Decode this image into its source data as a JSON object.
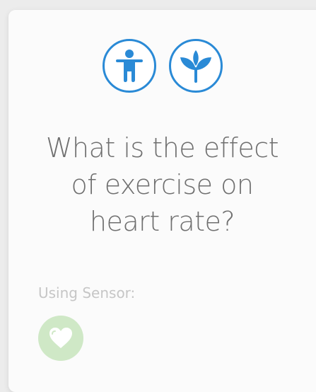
{
  "question": {
    "lines": [
      "What is the effect",
      "of exercise on",
      "heart rate?"
    ]
  },
  "topic_icons": [
    "person-icon",
    "plant-icon"
  ],
  "sensor": {
    "label": "Using Sensor:",
    "icon": "heart-icon"
  },
  "colors": {
    "accent_blue": "#2a8ad6",
    "sensor_green": "#cfe8c6",
    "question_text": "#6f6f6f",
    "label_text": "#c6c6c6"
  }
}
